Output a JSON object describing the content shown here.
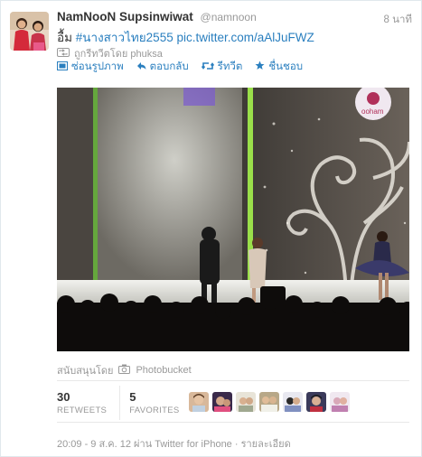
{
  "tweet": {
    "author_name": "NamNooN Supsinwiwat",
    "author_handle": "@namnoon",
    "time": "8 นาที",
    "text_prefix": "อื้ม ",
    "hashtag": "#นางสาวไทย2555",
    "pic_link": "pic.twitter.com/aAlJuFWZ",
    "retweeted_by": "ถูกรีทวีตโดย phuksa"
  },
  "actions": {
    "hide_photo": "ซ่อนรูปภาพ",
    "reply": "ตอบกลับ",
    "retweet": "รีทวีต",
    "favorite": "ชื่นชอบ"
  },
  "photo": {
    "credit_prefix": "สนับสนุนโดย",
    "credit_provider": "Photobucket",
    "logo_text": "ooham"
  },
  "stats": {
    "retweets_count": "30",
    "retweets_label": "RETWEETS",
    "favorites_count": "5",
    "favorites_label": "FAVORITES"
  },
  "footer": {
    "timestamp": "20:09 - 9 ส.ค. 12 ผ่าน Twitter for iPhone",
    "separator": " · ",
    "details": "รายละเอียด"
  },
  "colors": {
    "link": "#2a7fbf",
    "muted": "#999999"
  }
}
